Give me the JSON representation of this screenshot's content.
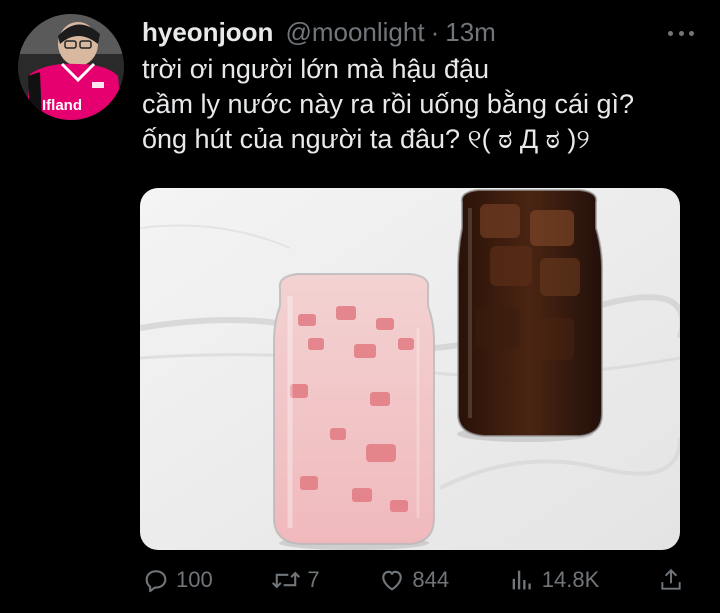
{
  "tweet": {
    "author_name": "hyeonjoon",
    "author_handle": "@moonlight",
    "time_separator": "·",
    "time": "13m",
    "text_lines": [
      "trời ơi người lớn mà hậu đậu",
      "cầm ly nước này ra rồi uống bằng cái gì?",
      "ống hút của người ta đâu? ୧( ಠ Д ಠ )୨"
    ],
    "avatar_jersey_text": "Ifland"
  },
  "actions": {
    "reply_count": "100",
    "retweet_count": "7",
    "like_count": "844",
    "view_count": "14.8K"
  },
  "colors": {
    "background": "#000000",
    "text_primary": "#e7e9ea",
    "text_secondary": "#71767b",
    "jersey_pink": "#e6006f"
  },
  "icons": [
    "reply-icon",
    "retweet-icon",
    "like-icon",
    "views-icon",
    "share-icon",
    "more-icon"
  ]
}
